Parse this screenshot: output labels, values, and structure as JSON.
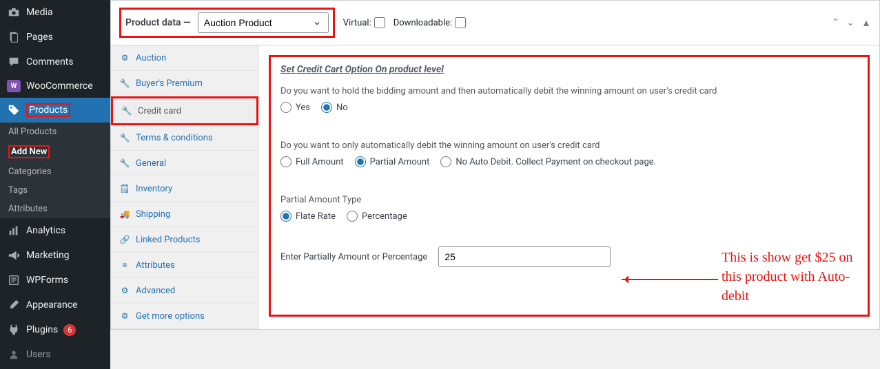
{
  "sidebar": {
    "items": [
      {
        "label": "Media",
        "icon": "camera"
      },
      {
        "label": "Pages",
        "icon": "page"
      },
      {
        "label": "Comments",
        "icon": "comment"
      },
      {
        "label": "WooCommerce",
        "icon": "woo"
      },
      {
        "label": "Products",
        "icon": "tag",
        "active": true
      },
      {
        "label": "Analytics",
        "icon": "chart"
      },
      {
        "label": "Marketing",
        "icon": "megaphone"
      },
      {
        "label": "WPForms",
        "icon": "form"
      },
      {
        "label": "Appearance",
        "icon": "brush"
      },
      {
        "label": "Plugins",
        "icon": "plug",
        "badge": "6"
      },
      {
        "label": "Users",
        "icon": "user"
      }
    ],
    "submenu": {
      "items": [
        {
          "label": "All Products"
        },
        {
          "label": "Add New",
          "current": true
        },
        {
          "label": "Categories"
        },
        {
          "label": "Tags"
        },
        {
          "label": "Attributes"
        }
      ]
    }
  },
  "product_data": {
    "header_label": "Product data —",
    "selected_type": "Auction Product",
    "virtual_label": "Virtual:",
    "downloadable_label": "Downloadable:"
  },
  "tabs": [
    {
      "label": "Auction",
      "icon": "gear"
    },
    {
      "label": "Buyer's Premium",
      "icon": "wrench"
    },
    {
      "label": "Credit card",
      "icon": "wrench",
      "active": true
    },
    {
      "label": "Terms & conditions",
      "icon": "wrench"
    },
    {
      "label": "General",
      "icon": "wrench"
    },
    {
      "label": "Inventory",
      "icon": "note"
    },
    {
      "label": "Shipping",
      "icon": "truck"
    },
    {
      "label": "Linked Products",
      "icon": "link"
    },
    {
      "label": "Attributes",
      "icon": "list"
    },
    {
      "label": "Advanced",
      "icon": "gear"
    },
    {
      "label": "Get more options",
      "icon": "gear"
    }
  ],
  "content": {
    "heading": "Set Credit Cart Option On product level",
    "q1_label": "Do you want to hold the bidding amount and then automatically debit the winning amount on user's credit card",
    "q1_opts": [
      "Yes",
      "No"
    ],
    "q1_selected": "No",
    "q2_label": "Do you want to only automatically debit the winning amount on user's credit card",
    "q2_opts": [
      "Full Amount",
      "Partial Amount",
      "No Auto Debit. Collect Payment on checkout page."
    ],
    "q2_selected": "Partial Amount",
    "q3_label": "Partial Amount Type",
    "q3_opts": [
      "Flate Rate",
      "Percentage"
    ],
    "q3_selected": "Flate Rate",
    "amount_label": "Enter Partially Amount or Percentage",
    "amount_value": "25"
  },
  "annotation": "This is show get $25 on this product with Auto-debit"
}
